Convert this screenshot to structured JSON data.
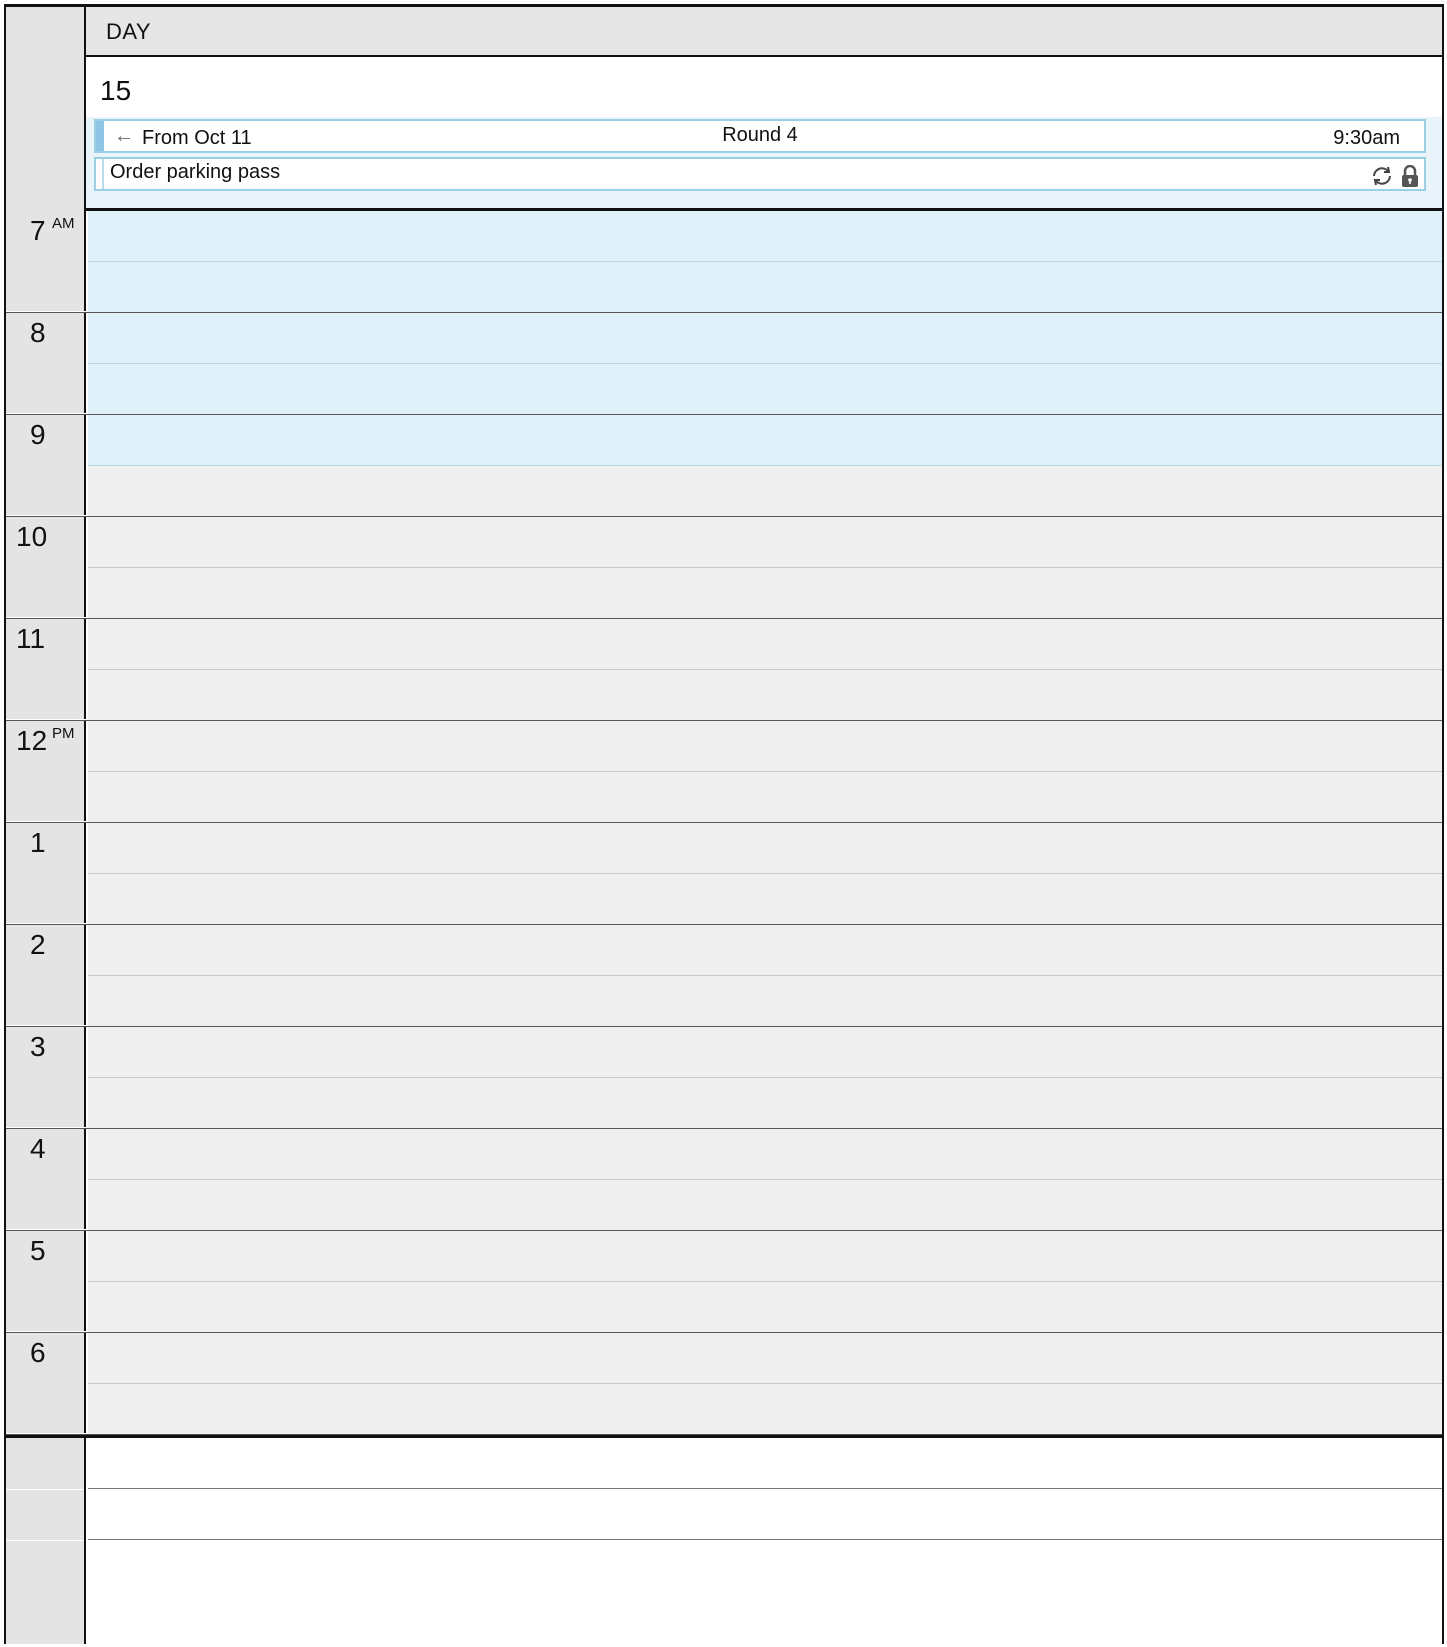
{
  "header": {
    "view_label": "DAY"
  },
  "day": {
    "number": "15"
  },
  "all_day_events": {
    "multi_day": {
      "from": "From Oct 11",
      "title": "Round 4",
      "time": "9:30am",
      "arrow_icon": "arrow-left-icon"
    },
    "task": {
      "title": "Order parking pass",
      "icons": [
        "sync-icon",
        "lock-icon"
      ]
    }
  },
  "hours": [
    {
      "label": "7",
      "suffix": "AM",
      "work": [
        true,
        true
      ]
    },
    {
      "label": "8",
      "suffix": "",
      "work": [
        true,
        true
      ]
    },
    {
      "label": "9",
      "suffix": "",
      "work": [
        true,
        false
      ]
    },
    {
      "label": "10",
      "suffix": "",
      "work": [
        false,
        false
      ]
    },
    {
      "label": "11",
      "suffix": "",
      "work": [
        false,
        false
      ]
    },
    {
      "label": "12",
      "suffix": "PM",
      "work": [
        false,
        false
      ]
    },
    {
      "label": "1",
      "suffix": "",
      "work": [
        false,
        false
      ]
    },
    {
      "label": "2",
      "suffix": "",
      "work": [
        false,
        false
      ]
    },
    {
      "label": "3",
      "suffix": "",
      "work": [
        false,
        false
      ]
    },
    {
      "label": "4",
      "suffix": "",
      "work": [
        false,
        false
      ]
    },
    {
      "label": "5",
      "suffix": "",
      "work": [
        false,
        false
      ]
    },
    {
      "label": "6",
      "suffix": "",
      "work": [
        false,
        false
      ]
    }
  ],
  "colors": {
    "work_hours": "#e0f0f8",
    "off_hours": "#efefef",
    "event_border": "#9ccfe6",
    "event_strip": "#8fc5e4"
  }
}
